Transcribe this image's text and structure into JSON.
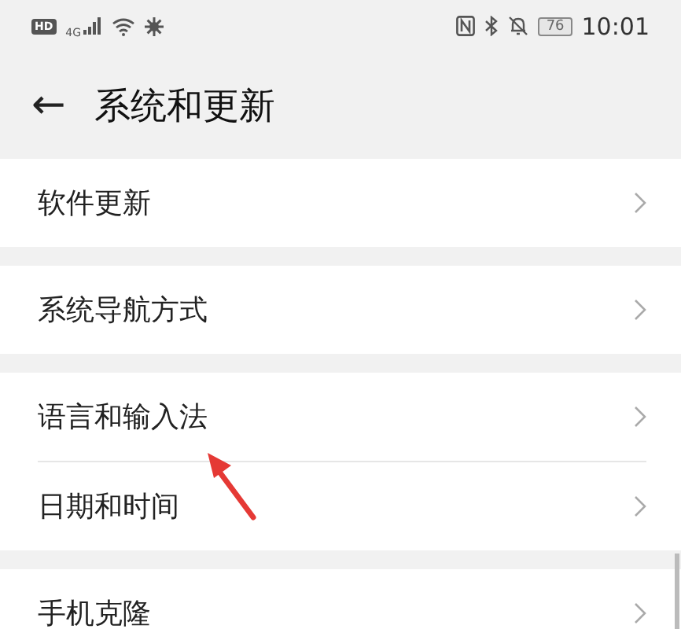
{
  "status_bar": {
    "hd_badge": "HD",
    "network_type": "4G",
    "battery": "76",
    "time": "10:01"
  },
  "header": {
    "back": "←",
    "title": "系统和更新"
  },
  "groups": [
    {
      "items": [
        {
          "label": "软件更新"
        }
      ]
    },
    {
      "items": [
        {
          "label": "系统导航方式"
        }
      ]
    },
    {
      "items": [
        {
          "label": "语言和输入法"
        },
        {
          "label": "日期和时间"
        }
      ]
    },
    {
      "items": [
        {
          "label": "手机克隆"
        }
      ]
    }
  ],
  "annotation": {
    "kind": "arrow",
    "color": "#e53935"
  }
}
